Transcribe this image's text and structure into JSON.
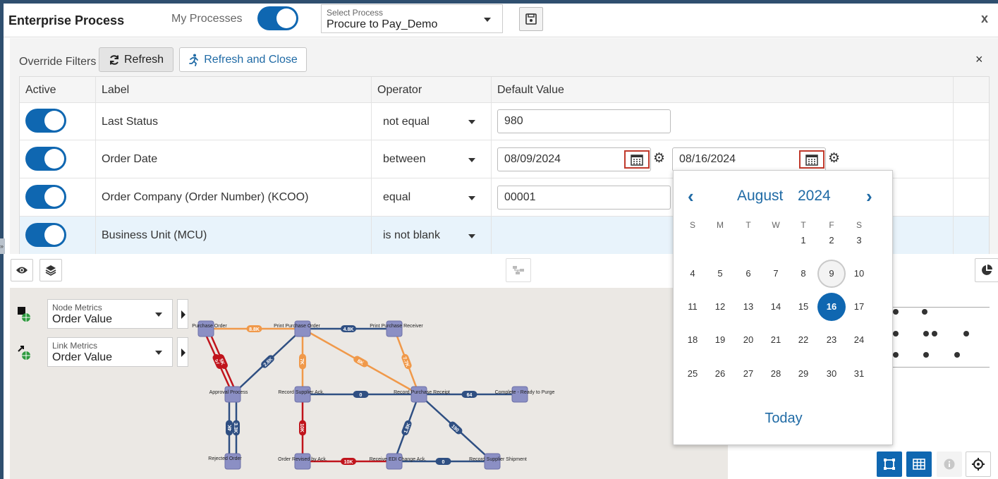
{
  "header": {
    "title": "Enterprise Process",
    "my_processes_label": "My Processes",
    "select_process_label": "Select Process",
    "select_process_value": "Procure to Pay_Demo",
    "close_label": "x"
  },
  "filters": {
    "override_label": "Override Filters",
    "refresh_label": "Refresh",
    "refresh_close_label": "Refresh and Close",
    "close_label": "×",
    "columns": [
      "Active",
      "Label",
      "Operator",
      "Default Value"
    ],
    "rows": [
      {
        "label": "Last Status",
        "operator": "not equal",
        "value": "980"
      },
      {
        "label": "Order Date",
        "operator": "between",
        "value": "08/09/2024",
        "value2": "08/16/2024"
      },
      {
        "label": "Order Company (Order Number) (KCOO)",
        "operator": "equal",
        "value": "00001"
      },
      {
        "label": "Business Unit (MCU)",
        "operator": "is not blank"
      }
    ]
  },
  "metrics": {
    "node_label": "Node Metrics",
    "node_value": "Order Value",
    "link_label": "Link Metrics",
    "link_value": "Order Value"
  },
  "graph": {
    "nodes": [
      {
        "id": "n1",
        "label": "Purchase Order"
      },
      {
        "id": "n2",
        "label": "Print Purchase Order"
      },
      {
        "id": "n3",
        "label": "Print Purchase Receiver"
      },
      {
        "id": "n4",
        "label": "Approval Process"
      },
      {
        "id": "n5",
        "label": "Record Supplier Ack."
      },
      {
        "id": "n6",
        "label": "Record Purchase Receipt"
      },
      {
        "id": "n7",
        "label": "Complete - Ready to Purge"
      },
      {
        "id": "n8",
        "label": "Rejected Order"
      },
      {
        "id": "n9",
        "label": "Order Revised by Ack."
      },
      {
        "id": "n10",
        "label": "Receive EDI Change Ack."
      },
      {
        "id": "n11",
        "label": "Record Supplier Shipment"
      }
    ],
    "links": [
      "8.8K",
      "4.8K",
      "57",
      "5K",
      "2.8K",
      "7K",
      "8K",
      "7.7K",
      "0",
      "64",
      "4K",
      "3.3K",
      "10K",
      "10K",
      "1.8K",
      "190",
      "0"
    ]
  },
  "datepicker": {
    "month": "August",
    "year": "2024",
    "weekdays": [
      "S",
      "M",
      "T",
      "W",
      "T",
      "F",
      "S"
    ],
    "days": [
      "1",
      "2",
      "3",
      "4",
      "5",
      "6",
      "7",
      "8",
      "9",
      "10",
      "11",
      "12",
      "13",
      "14",
      "15",
      "16",
      "17",
      "18",
      "19",
      "20",
      "21",
      "22",
      "23",
      "24",
      "25",
      "26",
      "27",
      "28",
      "29",
      "30",
      "31"
    ],
    "today_day": "9",
    "selected_day": "16",
    "today_label": "Today"
  },
  "colors": {
    "accent": "#0f67b1",
    "link_blue": "#2f4f82",
    "link_orange": "#f0994a",
    "link_red": "#c0141c",
    "highlight_border": "#c0392b"
  }
}
